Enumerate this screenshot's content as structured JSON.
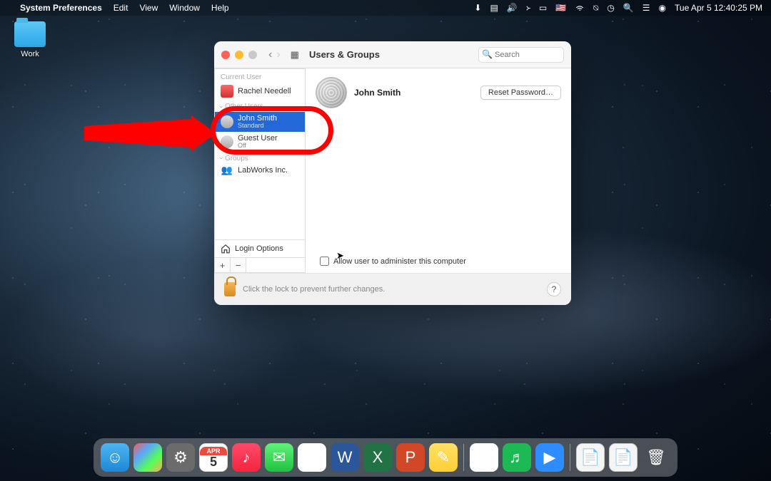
{
  "menubar": {
    "app": "System Preferences",
    "menus": [
      "Edit",
      "View",
      "Window",
      "Help"
    ],
    "datetime": "Tue Apr 5  12:40:25 PM"
  },
  "desktop": {
    "folder_label": "Work"
  },
  "window": {
    "title": "Users & Groups",
    "search_placeholder": "Search",
    "sidebar": {
      "current_label": "Current User",
      "current_name": "Rachel Needell",
      "other_label": "Other Users",
      "other": [
        {
          "name": "John Smith",
          "role": "Standard",
          "selected": true
        },
        {
          "name": "Guest User",
          "role": "Off",
          "selected": false
        }
      ],
      "groups_label": "Groups",
      "groups": [
        {
          "name": "LabWorks Inc."
        }
      ],
      "login_options": "Login Options"
    },
    "main": {
      "user_name": "John Smith",
      "reset_label": "Reset Password…",
      "admin_label": "Allow user to administer this computer"
    },
    "footer": {
      "lock_text": "Click the lock to prevent further changes."
    }
  },
  "dock": {
    "cal_month": "APR",
    "cal_day": "5"
  }
}
